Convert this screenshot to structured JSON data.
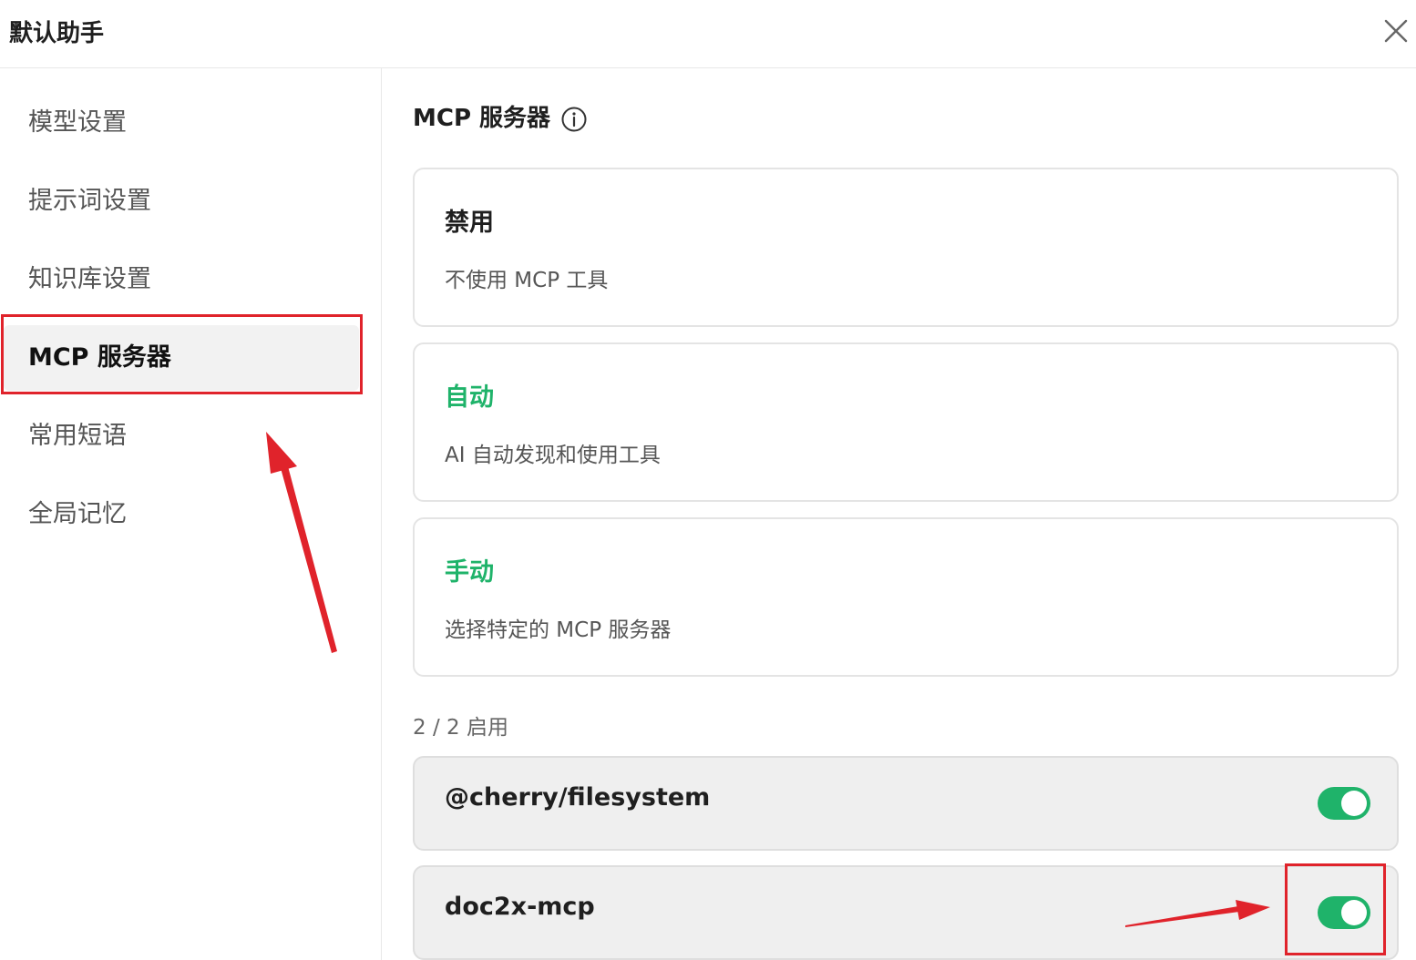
{
  "window": {
    "title": "默认助手"
  },
  "sidebar": {
    "items": [
      {
        "label": "模型设置",
        "active": false
      },
      {
        "label": "提示词设置",
        "active": false
      },
      {
        "label": "知识库设置",
        "active": false
      },
      {
        "label": "MCP 服务器",
        "active": true
      },
      {
        "label": "常用短语",
        "active": false
      },
      {
        "label": "全局记忆",
        "active": false
      }
    ]
  },
  "main": {
    "section_title": "MCP 服务器",
    "options": [
      {
        "title": "禁用",
        "description": "不使用 MCP 工具"
      },
      {
        "title": "自动",
        "description": "AI 自动发现和使用工具"
      },
      {
        "title": "手动",
        "description": "选择特定的 MCP 服务器"
      }
    ],
    "enabled_count": "2 / 2 启用",
    "servers": [
      {
        "name": "@cherry/filesystem",
        "enabled": true
      },
      {
        "name": "doc2x-mcp",
        "enabled": true
      }
    ]
  },
  "colors": {
    "accent_green": "#1fb36a",
    "annotation_red": "#e0232b",
    "active_bg": "#f2f2f2"
  },
  "icons": {
    "close": "close-icon",
    "info": "info-icon"
  }
}
